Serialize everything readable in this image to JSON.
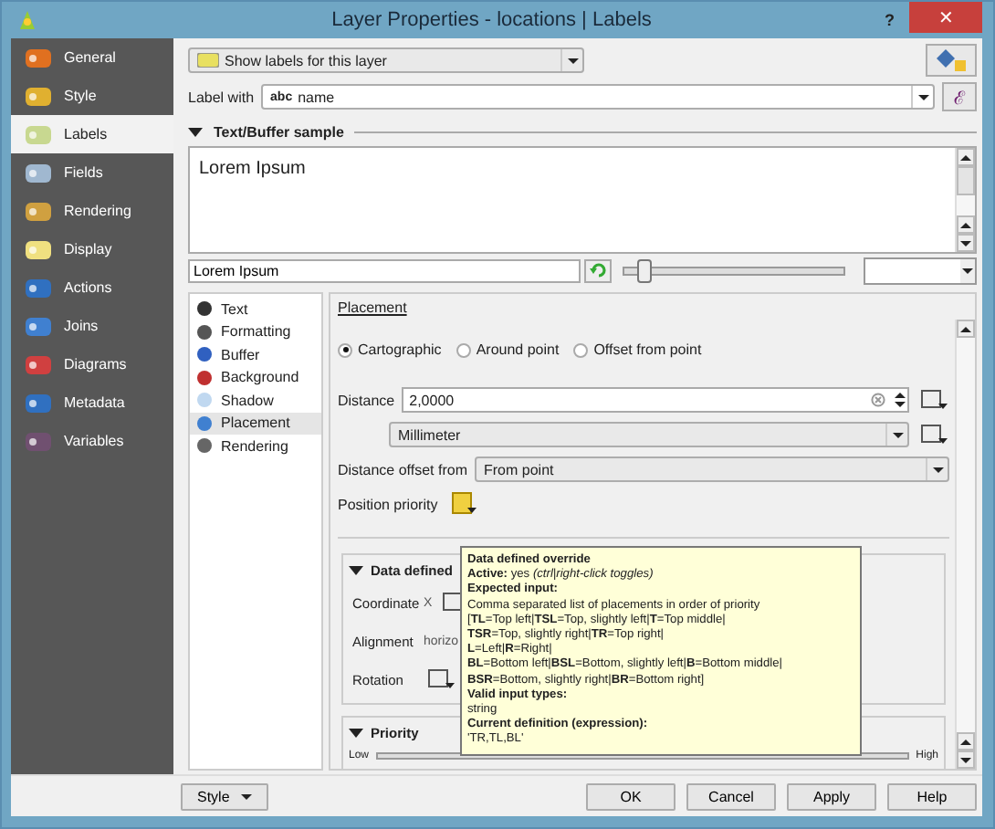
{
  "window": {
    "title": "Layer Properties - locations | Labels",
    "help": "?",
    "close": "✕"
  },
  "sidebar": {
    "items": [
      {
        "label": "General",
        "selected": false
      },
      {
        "label": "Style",
        "selected": false
      },
      {
        "label": "Labels",
        "selected": true
      },
      {
        "label": "Fields",
        "selected": false
      },
      {
        "label": "Rendering",
        "selected": false
      },
      {
        "label": "Display",
        "selected": false
      },
      {
        "label": "Actions",
        "selected": false
      },
      {
        "label": "Joins",
        "selected": false
      },
      {
        "label": "Diagrams",
        "selected": false
      },
      {
        "label": "Metadata",
        "selected": false
      },
      {
        "label": "Variables",
        "selected": false
      }
    ]
  },
  "mode_select": {
    "value": "Show labels for this layer"
  },
  "label_with": {
    "label": "Label with",
    "type_badge": "abc",
    "value": "name",
    "expression_button": "ℰ"
  },
  "sample": {
    "title": "Text/Buffer sample",
    "text": "Lorem Ipsum",
    "input": "Lorem Ipsum",
    "zoom_slider": {
      "level": 0.08
    }
  },
  "subnav": {
    "items": [
      {
        "label": "Text",
        "selected": false
      },
      {
        "label": "Formatting",
        "selected": false
      },
      {
        "label": "Buffer",
        "selected": false
      },
      {
        "label": "Background",
        "selected": false
      },
      {
        "label": "Shadow",
        "selected": false
      },
      {
        "label": "Placement",
        "selected": true
      },
      {
        "label": "Rendering",
        "selected": false
      }
    ]
  },
  "placement": {
    "heading": "Placement",
    "modes": [
      {
        "label": "Cartographic",
        "selected": true
      },
      {
        "label": "Around point",
        "selected": false
      },
      {
        "label": "Offset from point",
        "selected": false
      }
    ],
    "distance": {
      "label": "Distance",
      "value": "2,0000"
    },
    "unit": {
      "value": "Millimeter"
    },
    "offset_from": {
      "label": "Distance offset from",
      "value": "From point"
    },
    "position_priority": {
      "label": "Position priority"
    }
  },
  "data_defined": {
    "title": "Data defined",
    "rows": [
      {
        "label": "Coordinate",
        "value": "X"
      },
      {
        "label": "Alignment",
        "value": "horizo"
      },
      {
        "label": "Rotation"
      }
    ]
  },
  "priority": {
    "title": "Priority",
    "low": "Low",
    "high": "High"
  },
  "tooltip": {
    "lines": [
      "**Data defined override**",
      "**Active:** yes   *(ctrl|right-click toggles)*",
      "**Expected input:**",
      "Comma separated list of placements in order of priority",
      "[**TL**=Top left|**TSL**=Top, slightly left|**T**=Top middle|",
      "**TSR**=Top, slightly right|**TR**=Top right|",
      "**L**=Left|**R**=Right|",
      "**BL**=Bottom left|**BSL**=Bottom, slightly left|**B**=Bottom middle|",
      "**BSR**=Bottom, slightly right|**BR**=Bottom right]",
      "**Valid input types:**",
      "string",
      "**Current definition (expression):**",
      "'TR,TL,BL'"
    ]
  },
  "buttons": {
    "style": "Style",
    "actions": [
      "OK",
      "Cancel",
      "Apply",
      "Help"
    ]
  }
}
